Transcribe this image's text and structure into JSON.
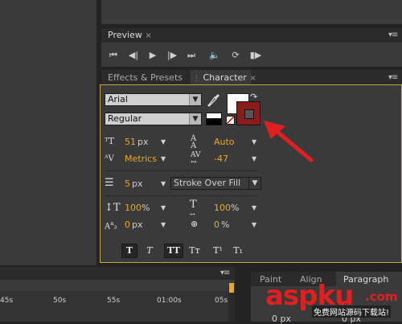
{
  "preview": {
    "tab_label": "Preview",
    "close": "×",
    "menu": "▾≡"
  },
  "tabs": {
    "effects_label": "Effects & Presets",
    "character_label": "Character",
    "close": "×",
    "menu": "▾≡"
  },
  "character": {
    "font_family": "Arial",
    "font_style": "Regular",
    "font_size": "51",
    "font_size_unit": "px",
    "leading": "Auto",
    "kerning": "Metrics",
    "tracking": "-47",
    "stroke_width": "5",
    "stroke_width_unit": "px",
    "stroke_mode": "Stroke Over Fill",
    "vert_scale": "100",
    "vert_scale_unit": "%",
    "horiz_scale": "100",
    "horiz_scale_unit": "%",
    "baseline_shift": "0",
    "baseline_shift_unit": "px",
    "tsume": "0",
    "tsume_unit": "%",
    "fill_color": "#ffffff",
    "stroke_color": "#8b1c1c",
    "style_buttons": [
      "T",
      "T",
      "TT",
      "Tᴛ",
      "T¹",
      "T₁"
    ]
  },
  "bottom_tabs": {
    "paint": "Paint",
    "align": "Align",
    "paragraph": "Paragraph"
  },
  "timeline": {
    "ticks": [
      "45s",
      "50s",
      "55s",
      "01:00s",
      "05s"
    ],
    "menu": "▾≡"
  },
  "bottom_values": [
    "0 px",
    "0 px"
  ],
  "watermark": {
    "brand": "aspku",
    "tld": ".com",
    "tagline": "免费网站源码下载站!"
  },
  "colors": {
    "accent_value": "#e5a92b",
    "panel_border_active": "#c8a23a",
    "arrow": "#e02020"
  },
  "icons": {
    "eyedropper": "eyedropper-icon",
    "swap": "swap-colors-icon"
  }
}
